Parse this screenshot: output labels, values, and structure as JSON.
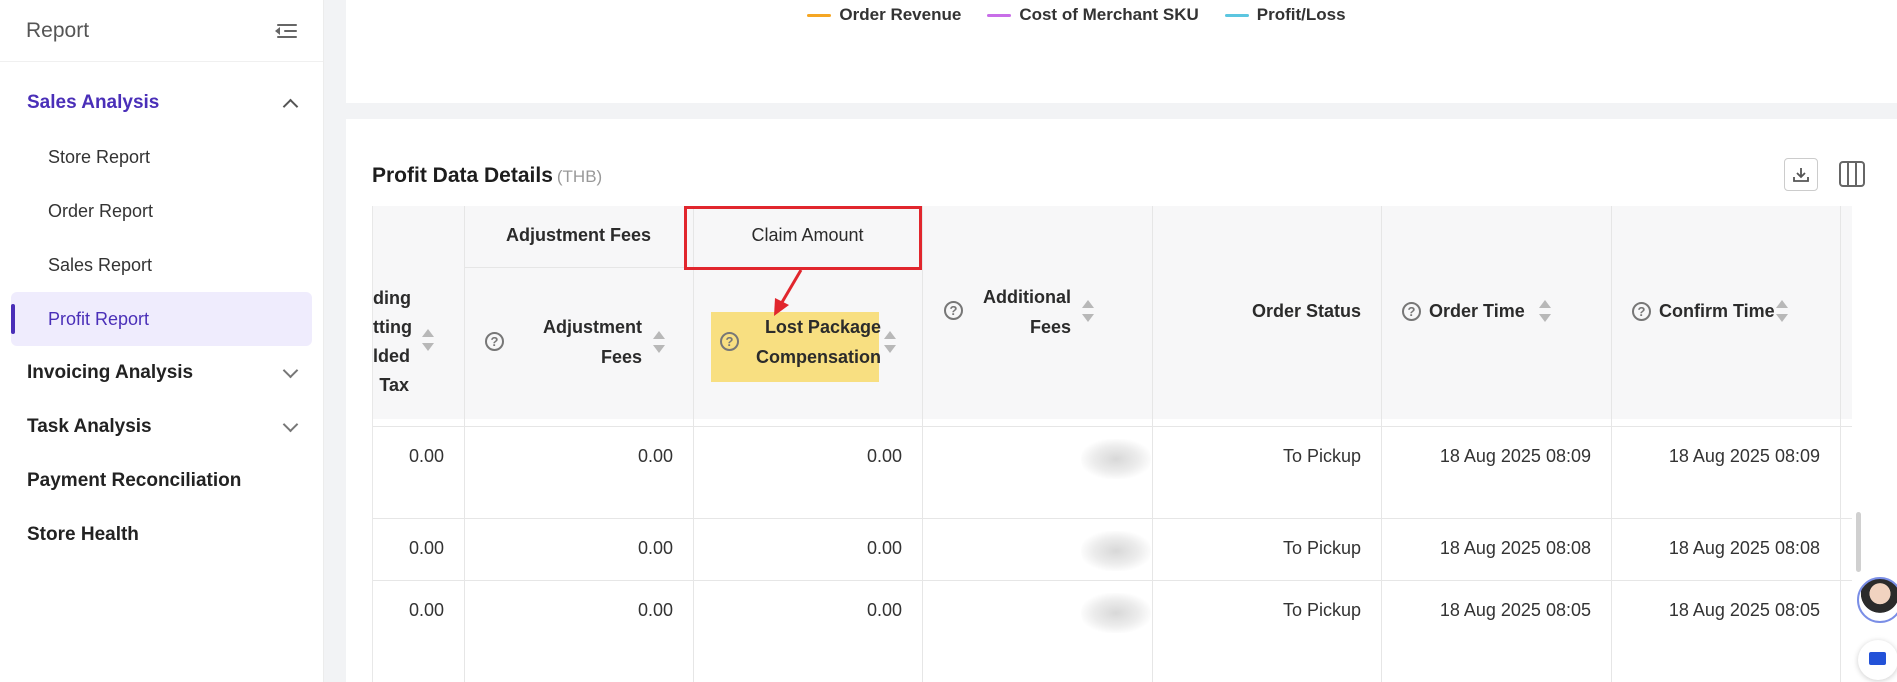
{
  "sidebar": {
    "title": "Report",
    "groups": [
      {
        "label": "Sales Analysis",
        "expanded": true
      },
      {
        "label": "Invoicing Analysis",
        "expanded": false
      },
      {
        "label": "Task Analysis",
        "expanded": false
      },
      {
        "label": "Payment Reconciliation"
      },
      {
        "label": "Store Health"
      }
    ],
    "sales_items": [
      "Store Report",
      "Order Report",
      "Sales Report",
      "Profit Report"
    ],
    "active_item": "Profit Report"
  },
  "chart_legend": [
    {
      "label": "Order Revenue",
      "color": "#f5a623"
    },
    {
      "label": "Cost of Merchant SKU",
      "color": "#c86ee8"
    },
    {
      "label": "Profit/Loss",
      "color": "#5cc6e0"
    }
  ],
  "details": {
    "title": "Profit Data Details",
    "unit": "(THB)"
  },
  "table": {
    "group_headers": {
      "adjustment": "Adjustment Fees",
      "claim": "Claim Amount"
    },
    "partial_header": [
      "ding",
      "tting",
      "lded",
      "Tax"
    ],
    "columns": {
      "adjustment_fees": [
        "Adjustment",
        "Fees"
      ],
      "lost_package": [
        "Lost Package",
        "Compensation"
      ],
      "additional_fees": [
        "Additional",
        "Fees"
      ],
      "order_status": "Order Status",
      "order_time": "Order Time",
      "confirm_time": "Confirm Time"
    },
    "rows": [
      {
        "tax": "0.00",
        "adjustment": "0.00",
        "lost": "0.00",
        "status": "To Pickup",
        "order_time": "18 Aug 2025 08:09",
        "confirm_time": "18 Aug 2025 08:09"
      },
      {
        "tax": "0.00",
        "adjustment": "0.00",
        "lost": "0.00",
        "status": "To Pickup",
        "order_time": "18 Aug 2025 08:08",
        "confirm_time": "18 Aug 2025 08:08"
      },
      {
        "tax": "0.00",
        "adjustment": "0.00",
        "lost": "0.00",
        "status": "To Pickup",
        "order_time": "18 Aug 2025 08:05",
        "confirm_time": "18 Aug 2025 08:05"
      }
    ]
  },
  "icons": {
    "question": "?"
  }
}
